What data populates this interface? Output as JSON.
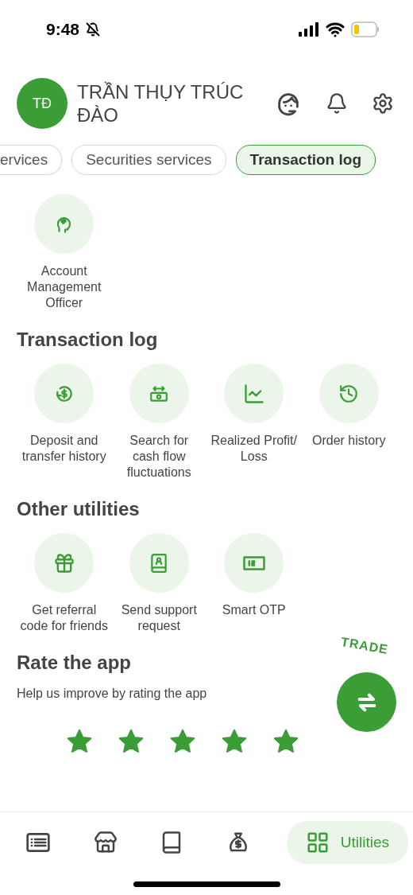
{
  "status_bar": {
    "time": "9:48"
  },
  "header": {
    "initials": "TĐ",
    "name": "TRẦN THỤY TRÚC ĐÀO"
  },
  "tabs": [
    {
      "label": "ervices",
      "selected": false
    },
    {
      "label": "Securities services",
      "selected": false
    },
    {
      "label": "Transaction log",
      "selected": true
    }
  ],
  "sections": [
    {
      "items": [
        {
          "label": "Account Management Officer"
        }
      ]
    },
    {
      "title": "Transaction log",
      "items": [
        {
          "label": "Deposit and transfer history"
        },
        {
          "label": "Search for cash flow fluctuations"
        },
        {
          "label": "Realized Profit/ Loss"
        },
        {
          "label": "Order history"
        }
      ]
    },
    {
      "title": "Other utilities",
      "items": [
        {
          "label": "Get referral code for friends"
        },
        {
          "label": "Send support request"
        },
        {
          "label": "Smart OTP"
        }
      ]
    }
  ],
  "rating": {
    "title": "Rate the app",
    "text": "Help us improve by rating the app",
    "stars": 5
  },
  "trade_button": {
    "label": "TRADE"
  },
  "bottom_nav": [
    {
      "selected": false
    },
    {
      "selected": false
    },
    {
      "selected": false
    },
    {
      "selected": false
    },
    {
      "label": "Utilities",
      "selected": true
    }
  ]
}
